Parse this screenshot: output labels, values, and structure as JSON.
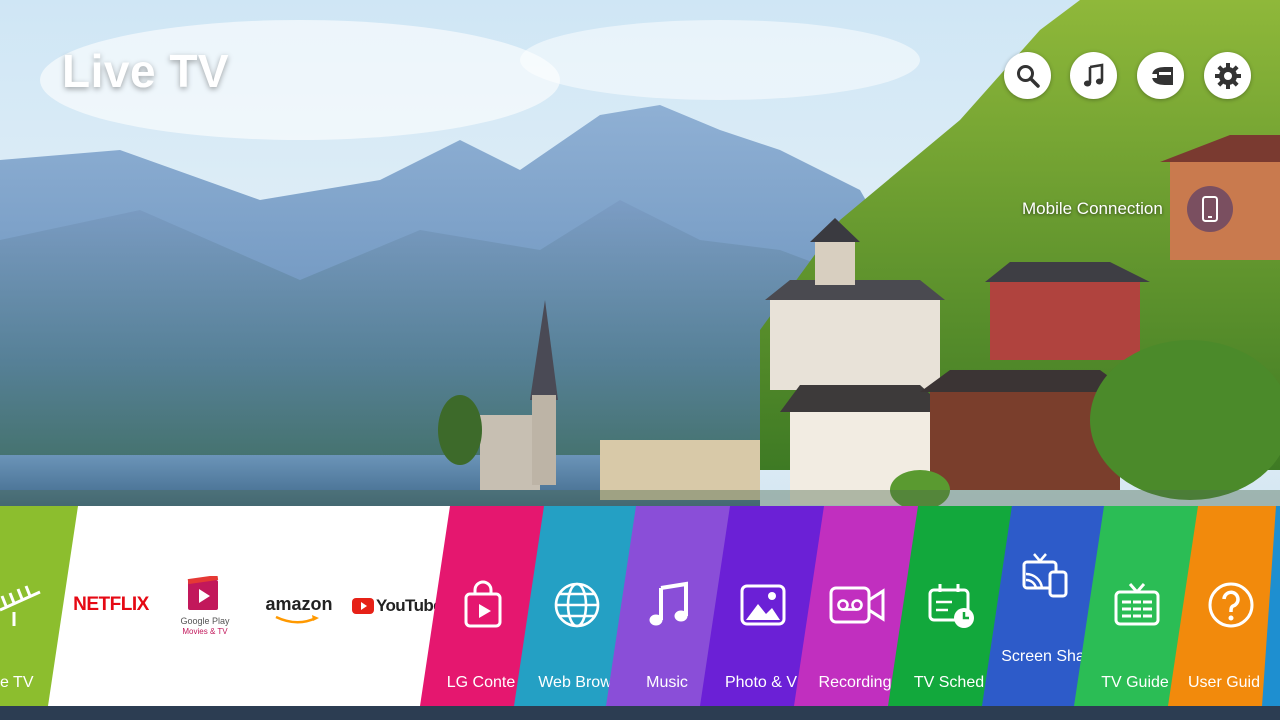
{
  "header": {
    "title": "Live TV"
  },
  "top_icons": [
    {
      "name": "search-icon"
    },
    {
      "name": "music-icon"
    },
    {
      "name": "input-icon"
    },
    {
      "name": "settings-icon"
    }
  ],
  "mobile": {
    "label": "Mobile Connection"
  },
  "launcher": {
    "tiles": [
      {
        "label": "Live TV",
        "visible_label": "e TV",
        "color": "#8cbe2e",
        "icon": "antenna-icon"
      },
      {
        "label": "NETFLIX",
        "color": "#ffffff"
      },
      {
        "label": "Google Play",
        "sub": "Movies & TV",
        "color": "#ffffff"
      },
      {
        "label": "amazon",
        "color": "#ffffff"
      },
      {
        "label": "YouTube",
        "color": "#ffffff"
      },
      {
        "label": "LG Content Store",
        "visible_label": "LG Conte",
        "color": "#e5176f",
        "icon": "store-bag-icon"
      },
      {
        "label": "Web Browser",
        "visible_label": "Web Brow",
        "color": "#24a0c4",
        "icon": "globe-icon"
      },
      {
        "label": "Music",
        "color": "#8a4ed8",
        "icon": "music-note-icon"
      },
      {
        "label": "Photo & Video",
        "visible_label": "Photo & V",
        "color": "#6b20d6",
        "icon": "photo-icon"
      },
      {
        "label": "Recordings",
        "visible_label": "Recording",
        "color": "#c12fbf",
        "icon": "recording-icon"
      },
      {
        "label": "TV Scheduler",
        "visible_label": "TV Sched",
        "color": "#12a83c",
        "icon": "scheduler-icon"
      },
      {
        "label": "Screen Share",
        "visible_label": "Screen Sha",
        "color": "#2d5bc9",
        "icon": "screen-share-icon"
      },
      {
        "label": "TV Guide",
        "color": "#2bbd55",
        "icon": "tv-guide-icon"
      },
      {
        "label": "User Guide",
        "visible_label": "User Guid",
        "color": "#f28a0c",
        "icon": "help-icon"
      }
    ]
  }
}
